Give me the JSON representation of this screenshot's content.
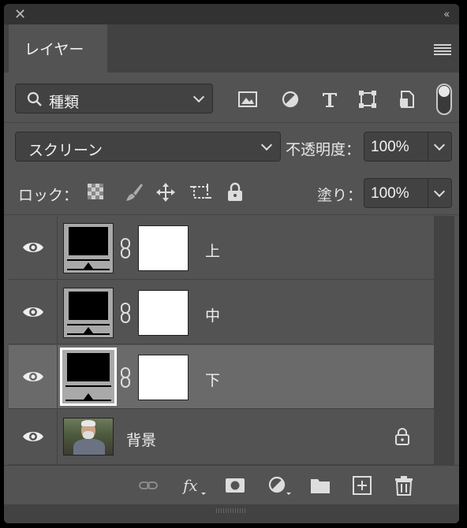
{
  "panel": {
    "tab_label": "レイヤー"
  },
  "filter": {
    "label": "種類",
    "icons": [
      "image-filter-icon",
      "adjustment-filter-icon",
      "type-filter-icon",
      "shape-filter-icon",
      "smart-object-filter-icon"
    ]
  },
  "blend": {
    "mode": "スクリーン",
    "opacity_label": "不透明度：",
    "opacity_value": "100%"
  },
  "lock": {
    "label": "ロック：",
    "fill_label": "塗り：",
    "fill_value": "100%"
  },
  "layers": [
    {
      "name": "上",
      "selected": false
    },
    {
      "name": "中",
      "selected": false
    },
    {
      "name": "下",
      "selected": true
    },
    {
      "name": "背景",
      "locked": true
    }
  ],
  "colors": {
    "panel_bg": "#535353",
    "field_bg": "#424242",
    "selected_row": "#6a6a6a",
    "titlebar": "#323232"
  }
}
